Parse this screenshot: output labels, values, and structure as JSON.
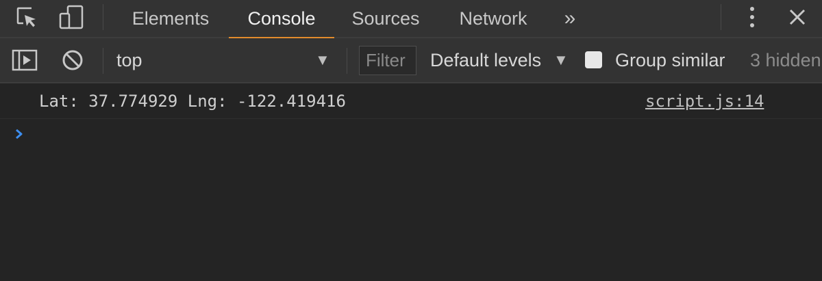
{
  "tabbar": {
    "tabs": [
      {
        "label": "Elements"
      },
      {
        "label": "Console"
      },
      {
        "label": "Sources"
      },
      {
        "label": "Network"
      }
    ],
    "active_tab": "Console",
    "overflow_glyph": "»",
    "icons": [
      "inspect-element-icon",
      "device-toggle-icon",
      "more-menu-icon",
      "close-icon"
    ]
  },
  "toolbar": {
    "context": "top",
    "filter_placeholder": "Filter",
    "levels_label": "Default levels",
    "group_similar_label": "Group similar",
    "group_similar_checked": false,
    "hidden_count_label": "3 hidden",
    "icons": [
      "show-sidebar-icon",
      "clear-console-icon",
      "dropdown-arrow-icon"
    ]
  },
  "console": {
    "messages": [
      {
        "text": "Lat: 37.774929 Lng: -122.419416",
        "source": "script.js:14"
      }
    ],
    "prompt_icon": "prompt-chevron-icon"
  },
  "colors": {
    "background": "#242424",
    "toolbar": "#333333",
    "active_tab_underline": "#e38b2c",
    "prompt_chevron": "#3d8ef0"
  }
}
